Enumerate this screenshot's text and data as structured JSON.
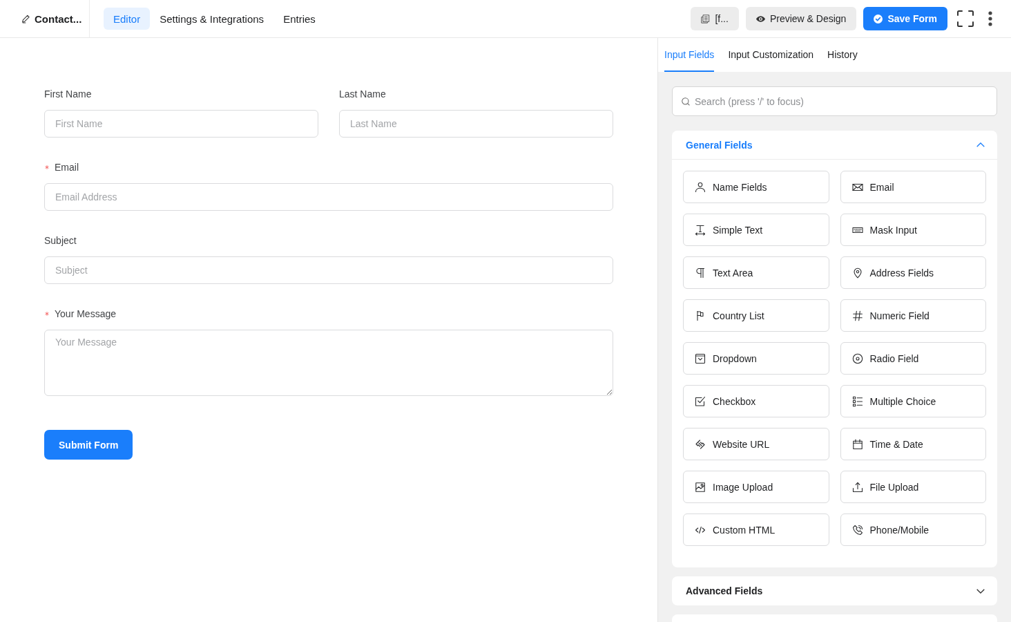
{
  "header": {
    "form_title": "Contact...",
    "tabs": [
      {
        "label": "Editor",
        "selected": true
      },
      {
        "label": "Settings & Integrations",
        "selected": false
      },
      {
        "label": "Entries",
        "selected": false
      }
    ],
    "actions": [
      {
        "kind": "shortcode",
        "label": "[f..."
      },
      {
        "kind": "preview",
        "label": "Preview & Design"
      },
      {
        "kind": "save",
        "label": "Save Form"
      }
    ]
  },
  "form": {
    "rows": [
      {
        "fields": [
          {
            "kind": "input",
            "label": "First Name",
            "placeholder": "First Name",
            "required": false
          },
          {
            "kind": "input",
            "label": "Last Name",
            "placeholder": "Last Name",
            "required": false
          }
        ]
      },
      {
        "fields": [
          {
            "kind": "input",
            "label": "Email",
            "placeholder": "Email Address",
            "required": true
          }
        ]
      },
      {
        "fields": [
          {
            "kind": "input",
            "label": "Subject",
            "placeholder": "Subject",
            "required": false
          }
        ]
      },
      {
        "fields": [
          {
            "kind": "textarea",
            "label": "Your Message",
            "placeholder": "Your Message",
            "required": true
          }
        ]
      }
    ],
    "submit_button": "Submit Form"
  },
  "sidebar": {
    "tabs": [
      {
        "label": "Input Fields",
        "selected": true
      },
      {
        "label": "Input Customization",
        "selected": false
      },
      {
        "label": "History",
        "selected": false
      }
    ],
    "search": {
      "placeholder": "Search (press '/' to focus)"
    },
    "sections": [
      {
        "title": "General Fields",
        "expanded": true,
        "items": [
          {
            "label": "Name Fields",
            "kind": "name"
          },
          {
            "label": "Email",
            "kind": "email"
          },
          {
            "label": "Simple Text",
            "kind": "text"
          },
          {
            "label": "Mask Input",
            "kind": "mask"
          },
          {
            "label": "Text Area",
            "kind": "textarea"
          },
          {
            "label": "Address Fields",
            "kind": "address"
          },
          {
            "label": "Country List",
            "kind": "country"
          },
          {
            "label": "Numeric Field",
            "kind": "number"
          },
          {
            "label": "Dropdown",
            "kind": "select"
          },
          {
            "label": "Radio Field",
            "kind": "radio"
          },
          {
            "label": "Checkbox",
            "kind": "checkbox"
          },
          {
            "label": "Multiple Choice",
            "kind": "multiple"
          },
          {
            "label": "Website URL",
            "kind": "url"
          },
          {
            "label": "Time & Date",
            "kind": "date"
          },
          {
            "label": "Image Upload",
            "kind": "image"
          },
          {
            "label": "File Upload",
            "kind": "file"
          },
          {
            "label": "Custom HTML",
            "kind": "html"
          },
          {
            "label": "Phone/Mobile",
            "kind": "phone"
          }
        ]
      },
      {
        "title": "Advanced Fields",
        "expanded": false
      }
    ]
  }
}
